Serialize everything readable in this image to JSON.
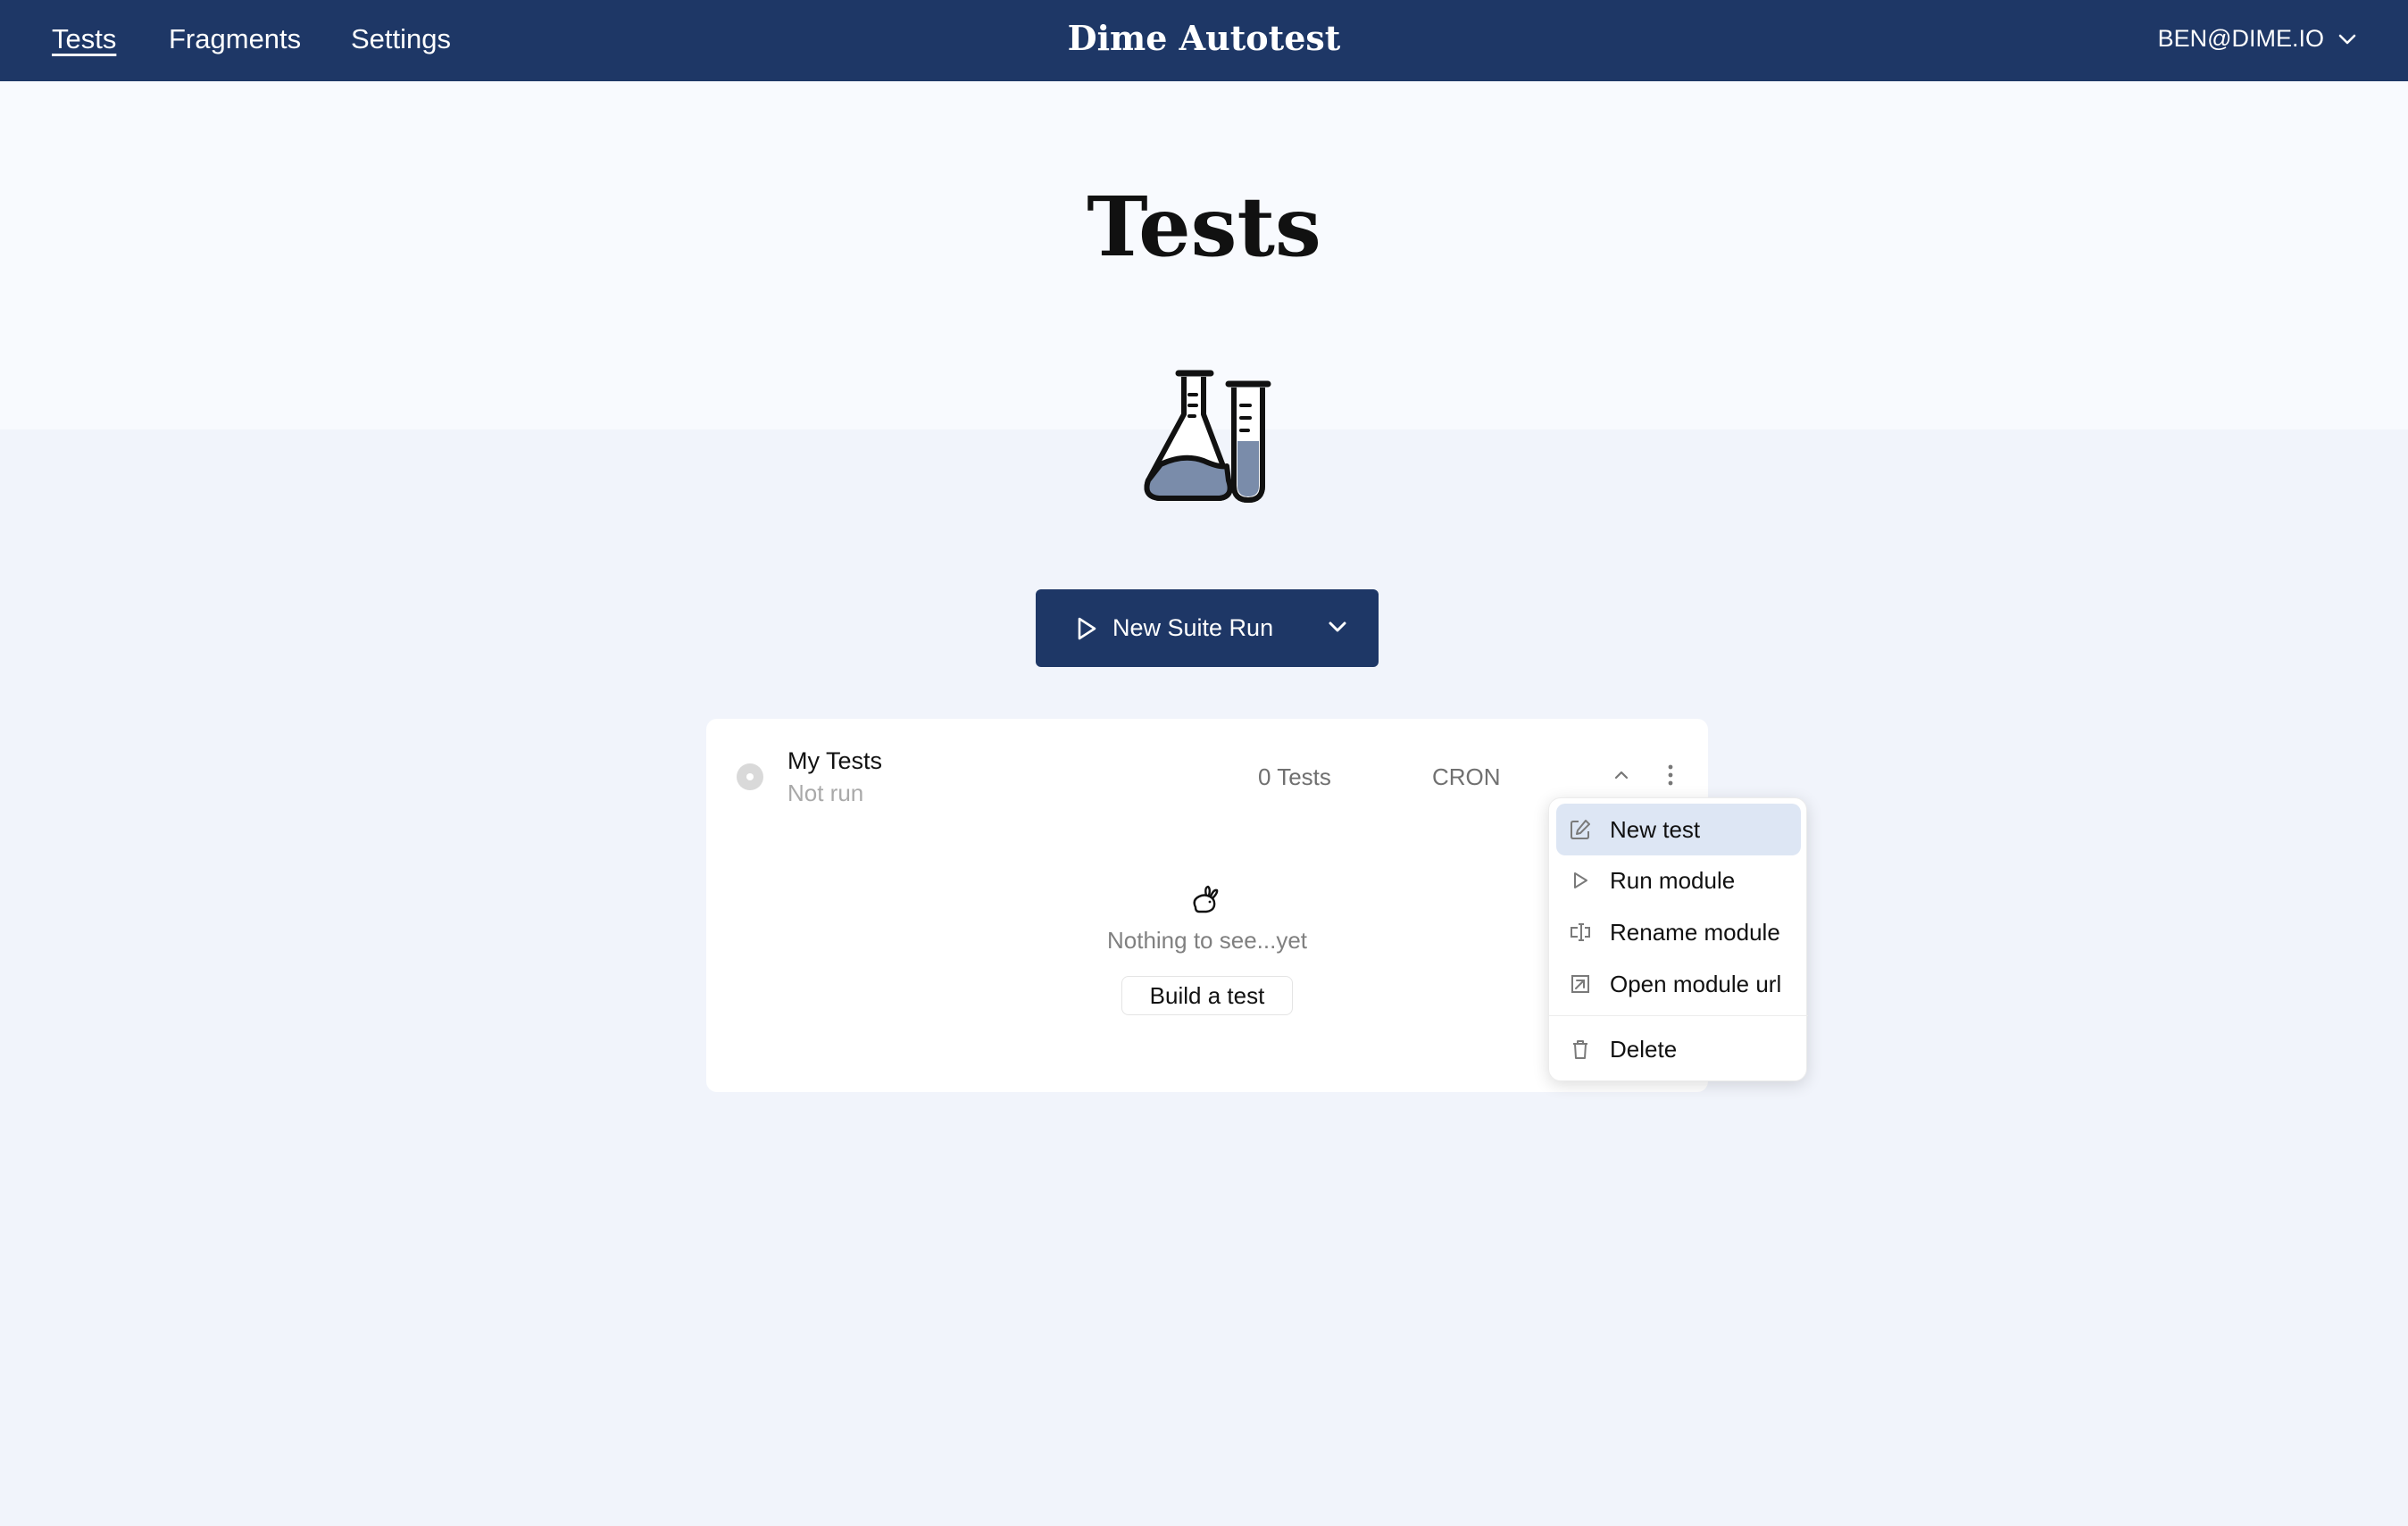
{
  "nav": {
    "links": [
      "Tests",
      "Fragments",
      "Settings"
    ],
    "brand": "Dime Autotest",
    "user": "BEN@DIME.IO"
  },
  "page": {
    "title": "Tests",
    "hero_icon": "flask-test-tube-icon"
  },
  "suite_run": {
    "label": "New Suite Run",
    "icon": "play-icon",
    "caret_icon": "chevron-down-icon"
  },
  "module": {
    "name": "My Tests",
    "status": "Not run",
    "test_count": "0 Tests",
    "schedule": "CRON",
    "empty_text": "Nothing to see...yet",
    "empty_icon": "rabbit-icon",
    "build_label": "Build a test"
  },
  "menu": {
    "items": [
      {
        "label": "New test",
        "icon": "edit-icon"
      },
      {
        "label": "Run module",
        "icon": "play-icon"
      },
      {
        "label": "Rename module",
        "icon": "text-cursor-icon"
      },
      {
        "label": "Open module url",
        "icon": "external-link-icon"
      },
      {
        "label": "Delete",
        "icon": "trash-icon"
      }
    ]
  },
  "colors": {
    "navy": "#1e3766",
    "menu_highlight": "#dde6f4",
    "page_bg": "#f1f4fb"
  }
}
